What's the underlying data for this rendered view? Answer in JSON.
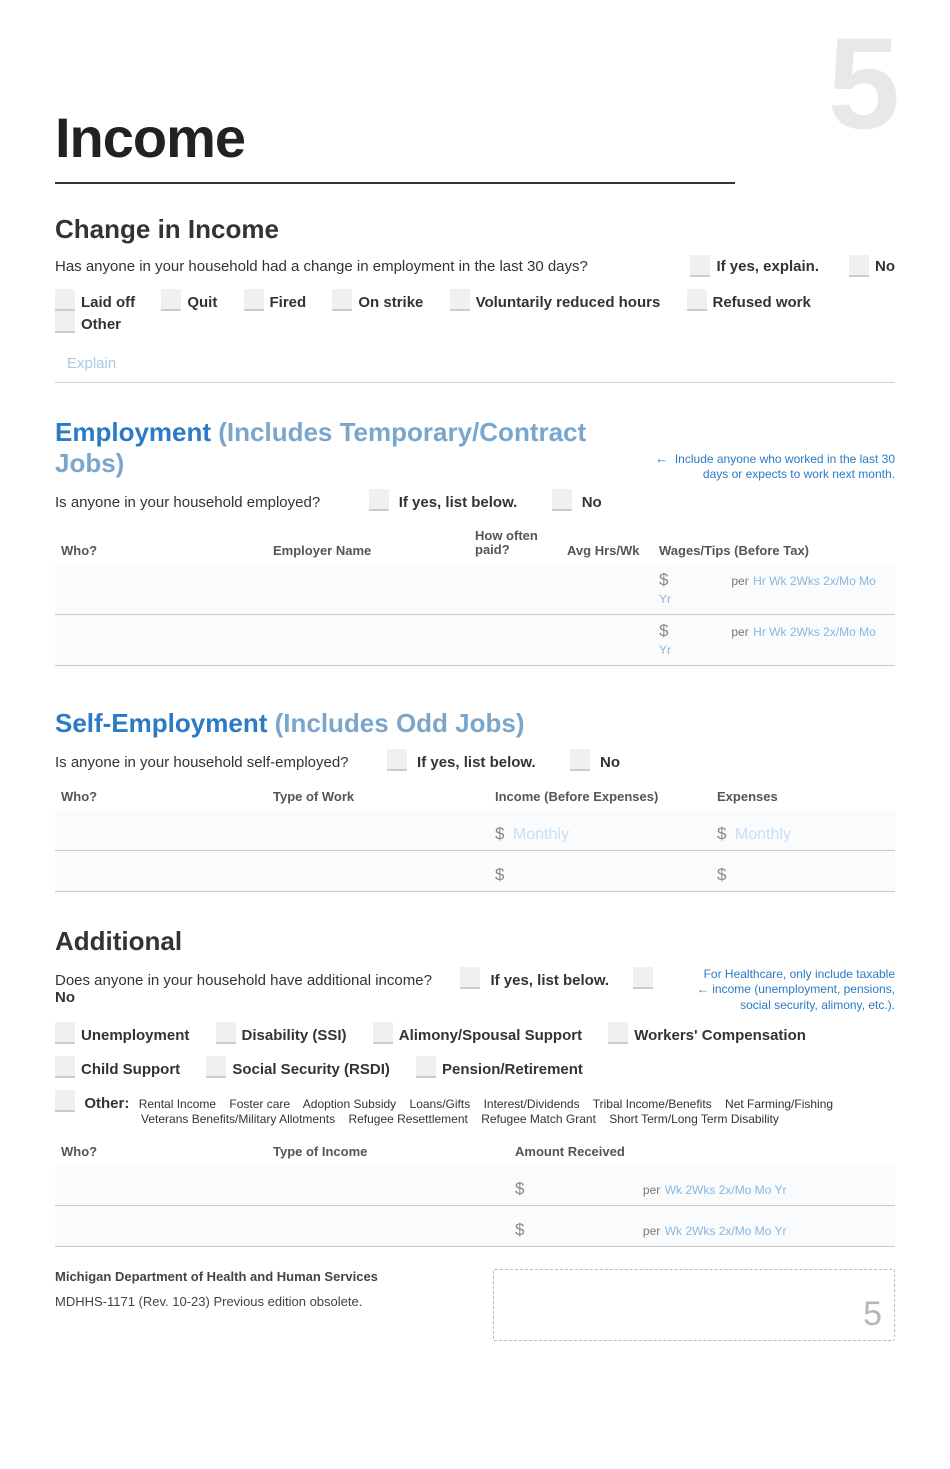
{
  "page": {
    "big_number": "5",
    "title": "Income"
  },
  "change": {
    "heading": "Change in Income",
    "q1": "Has anyone in your household had a change in employment in the last 30 days?",
    "if_yes": "If yes, explain.",
    "no": "No",
    "opts": [
      "Laid off",
      "Quit",
      "Fired",
      "On strike",
      "Voluntarily reduced hours",
      "Refused work",
      "Other"
    ],
    "explain_ph": "Explain"
  },
  "employment": {
    "heading_a": "Employment",
    "heading_b": " (Includes Temporary/Contract Jobs)",
    "hint_a": "Include anyone who worked in the last 30",
    "hint_b": "days or expects to work next month.",
    "arrow": "←",
    "q": "Is anyone in your household employed?",
    "if_yes": "If yes, list below.",
    "no": "No",
    "cols": {
      "who": "Who?",
      "employer": "Employer Name",
      "how_often_a": "How often",
      "how_often_b": "paid?",
      "avg_a": "Avg Hrs/Wk",
      "wages": "Wages/Tips (Before Tax)"
    },
    "per": "per",
    "freq": "Hr  Wk  2Wks  2x/Mo  Mo  Yr"
  },
  "selfemp": {
    "heading_a": "Self-Employment",
    "heading_b": " (Includes Odd Jobs)",
    "q": "Is anyone in your household self-employed?",
    "if_yes": "If yes, list below.",
    "no": "No",
    "cols": {
      "who": "Who?",
      "type": "Type of Work",
      "income": "Income (Before Expenses)",
      "expenses": "Expenses"
    },
    "monthly_ph": "Monthly"
  },
  "additional": {
    "heading": "Additional",
    "q": "Does anyone in your household have additional income?",
    "if_yes": "If yes, list below.",
    "no": "No",
    "hint_a": "For Healthcare, only include taxable",
    "hint_arrow": "←",
    "hint_b": "income (unemployment, pensions,",
    "hint_c": "social security, alimony, etc.).",
    "row1": [
      "Unemployment",
      "Disability (SSI)",
      "Alimony/Spousal Support",
      "Workers' Compensation"
    ],
    "row2": [
      "Child Support",
      "Social Security (RSDI)",
      "Pension/Retirement"
    ],
    "other_label": "Other:",
    "other_opts1": [
      "Rental Income",
      "Foster care",
      "Adoption Subsidy",
      "Loans/Gifts",
      "Interest/Dividends",
      "Tribal Income/Benefits",
      "Net Farming/Fishing"
    ],
    "other_opts2": [
      "Veterans Benefits/Military Allotments",
      "Refugee Resettlement",
      "Refugee Match Grant",
      "Short Term/Long Term Disability"
    ],
    "cols": {
      "who": "Who?",
      "type": "Type of Income",
      "amount": "Amount Received"
    },
    "per": "per",
    "freq": "Wk  2Wks  2x/Mo  Mo  Yr"
  },
  "footer": {
    "dept": "Michigan Department of Health and Human Services",
    "rev": "MDHHS-1171 (Rev. 10-23) Previous edition obsolete.",
    "page_no": "5"
  }
}
